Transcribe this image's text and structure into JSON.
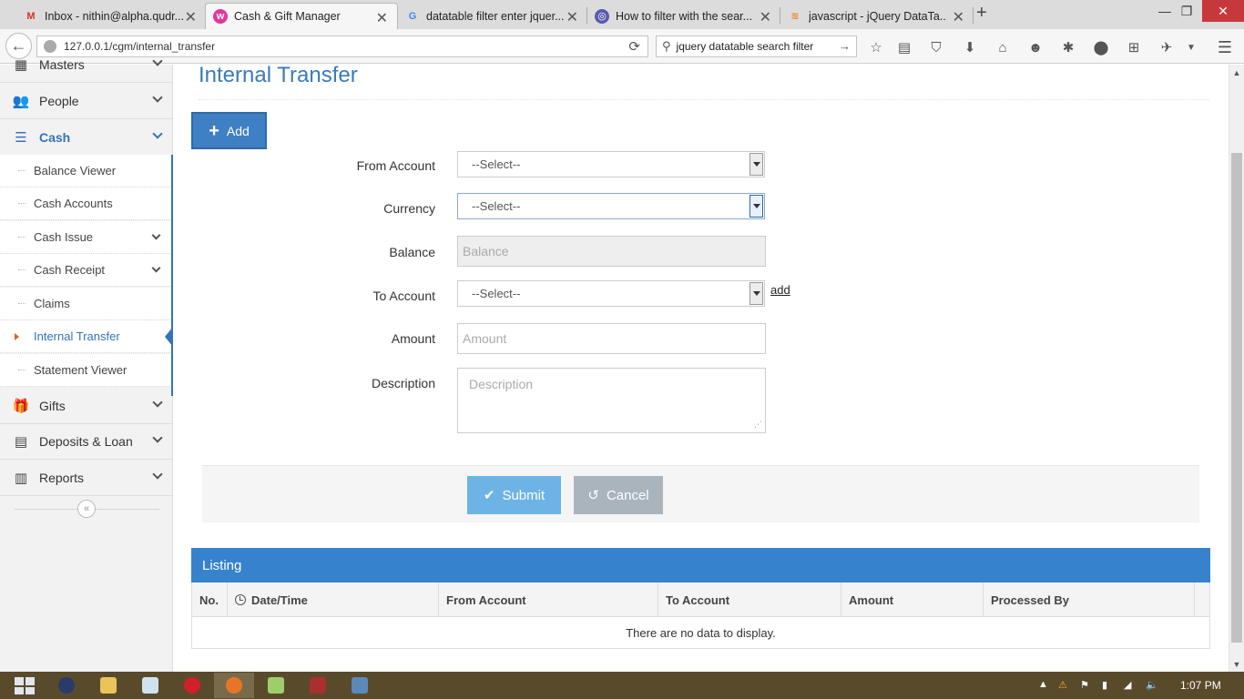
{
  "browser": {
    "tabs": [
      {
        "title": "Inbox - nithin@alpha.qudr...",
        "favicon": "gmail-icon",
        "active": false
      },
      {
        "title": "Cash & Gift Manager",
        "favicon": "app-icon",
        "active": true
      },
      {
        "title": "datatable filter enter jquer...",
        "favicon": "google-icon",
        "active": false
      },
      {
        "title": "How to filter with the sear...",
        "favicon": "site-icon",
        "active": false
      },
      {
        "title": "javascript - jQuery DataTa...",
        "favicon": "stackoverflow-icon",
        "active": false
      }
    ],
    "url": "127.0.0.1/cgm/internal_transfer",
    "search_query": "jquery datatable search filter"
  },
  "sidebar": {
    "items": [
      {
        "label": "Masters",
        "icon": "grid-icon"
      },
      {
        "label": "People",
        "icon": "people-icon"
      },
      {
        "label": "Cash",
        "icon": "database-icon",
        "open": true
      },
      {
        "label": "Gifts",
        "icon": "gift-icon"
      },
      {
        "label": "Deposits & Loan",
        "icon": "list-icon"
      },
      {
        "label": "Reports",
        "icon": "bar-chart-icon"
      }
    ],
    "cash_sub": [
      {
        "label": "Balance Viewer"
      },
      {
        "label": "Cash Accounts"
      },
      {
        "label": "Cash Issue",
        "expandable": true
      },
      {
        "label": "Cash Receipt",
        "expandable": true
      },
      {
        "label": "Claims"
      },
      {
        "label": "Internal Transfer",
        "active": true
      },
      {
        "label": "Statement Viewer"
      }
    ]
  },
  "page": {
    "title": "Internal Transfer",
    "add_label": "Add"
  },
  "form": {
    "from_account": {
      "label": "From Account",
      "value": "--Select--"
    },
    "currency": {
      "label": "Currency",
      "value": "--Select--"
    },
    "balance": {
      "label": "Balance",
      "placeholder": "Balance"
    },
    "to_account": {
      "label": "To Account",
      "value": "--Select--",
      "add_link": "add"
    },
    "amount": {
      "label": "Amount",
      "placeholder": "Amount"
    },
    "description": {
      "label": "Description",
      "placeholder": "Description"
    },
    "submit_label": "Submit",
    "cancel_label": "Cancel"
  },
  "listing": {
    "title": "Listing",
    "columns": [
      "No.",
      "Date/Time",
      "From Account",
      "To Account",
      "Amount",
      "Processed By"
    ],
    "empty_message": "There are no data to display."
  },
  "taskbar": {
    "time": "1:07 PM"
  },
  "colors": {
    "accent": "#3473b5",
    "listing_header": "#3682cc",
    "submit": "#6eb3e5",
    "cancel": "#a9b4bd"
  }
}
